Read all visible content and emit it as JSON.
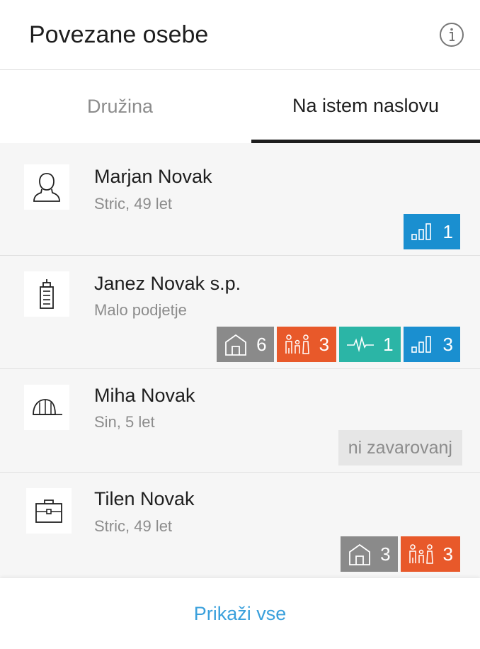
{
  "header": {
    "title": "Povezane osebe",
    "info_icon": "info-icon"
  },
  "tabs": [
    {
      "label": "Družina",
      "active": false
    },
    {
      "label": "Na istem naslovu",
      "active": true
    }
  ],
  "colors": {
    "property": "#8a8a8a",
    "family": "#e8592a",
    "health": "#2bb5a6",
    "savings": "#1a8fd0",
    "link": "#3aa0dc"
  },
  "persons": [
    {
      "name": "Marjan Novak",
      "detail": "Stric, 49 let",
      "icon": "person-icon",
      "badges": [
        {
          "type": "savings",
          "icon": "bars-icon",
          "count": "1"
        }
      ]
    },
    {
      "name": "Janez Novak s.p.",
      "detail": "Malo podjetje",
      "icon": "building-icon",
      "badges": [
        {
          "type": "property",
          "icon": "house-icon",
          "count": "6"
        },
        {
          "type": "family",
          "icon": "family-icon",
          "count": "3"
        },
        {
          "type": "health",
          "icon": "pulse-icon",
          "count": "1"
        },
        {
          "type": "savings",
          "icon": "bars-icon",
          "count": "3"
        }
      ]
    },
    {
      "name": "Miha Novak",
      "detail": "Sin, 5 let",
      "icon": "cap-icon",
      "no_insurance": "ni zavarovanj",
      "badges": []
    },
    {
      "name": "Tilen Novak",
      "detail": "Stric, 49 let",
      "icon": "briefcase-icon",
      "badges": [
        {
          "type": "property",
          "icon": "house-icon",
          "count": "3"
        },
        {
          "type": "family",
          "icon": "family-icon",
          "count": "3"
        }
      ]
    }
  ],
  "footer": {
    "show_all_label": "Prikaži vse"
  }
}
